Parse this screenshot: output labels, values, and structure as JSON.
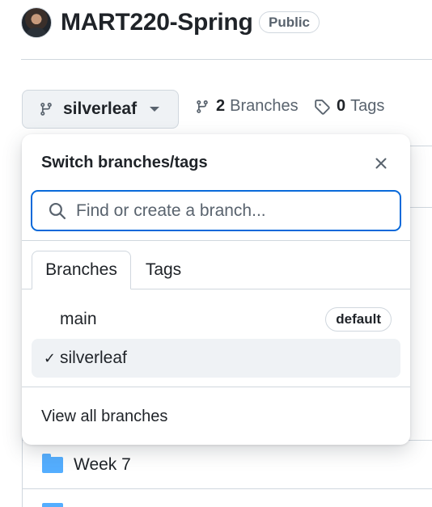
{
  "repo": {
    "name": "MART220-Spring",
    "visibility": "Public"
  },
  "branch_bar": {
    "current_branch": "silverleaf",
    "branches_count": "2",
    "branches_label": "Branches",
    "tags_count": "0",
    "tags_label": "Tags"
  },
  "dropdown": {
    "title": "Switch branches/tags",
    "search_placeholder": "Find or create a branch...",
    "tabs": [
      {
        "label": "Branches",
        "active": true
      },
      {
        "label": "Tags",
        "active": false
      }
    ],
    "items": [
      {
        "label": "main",
        "badge": "default",
        "selected": false
      },
      {
        "label": "silverleaf",
        "badge": "",
        "selected": true,
        "check": "✓"
      }
    ],
    "footer_link": "View all branches"
  },
  "files": [
    {
      "name": "Week 7",
      "type": "folder"
    }
  ],
  "colors": {
    "accent": "#0969da",
    "folder": "#54aeff",
    "border": "#d0d7de",
    "muted": "#59636e"
  }
}
